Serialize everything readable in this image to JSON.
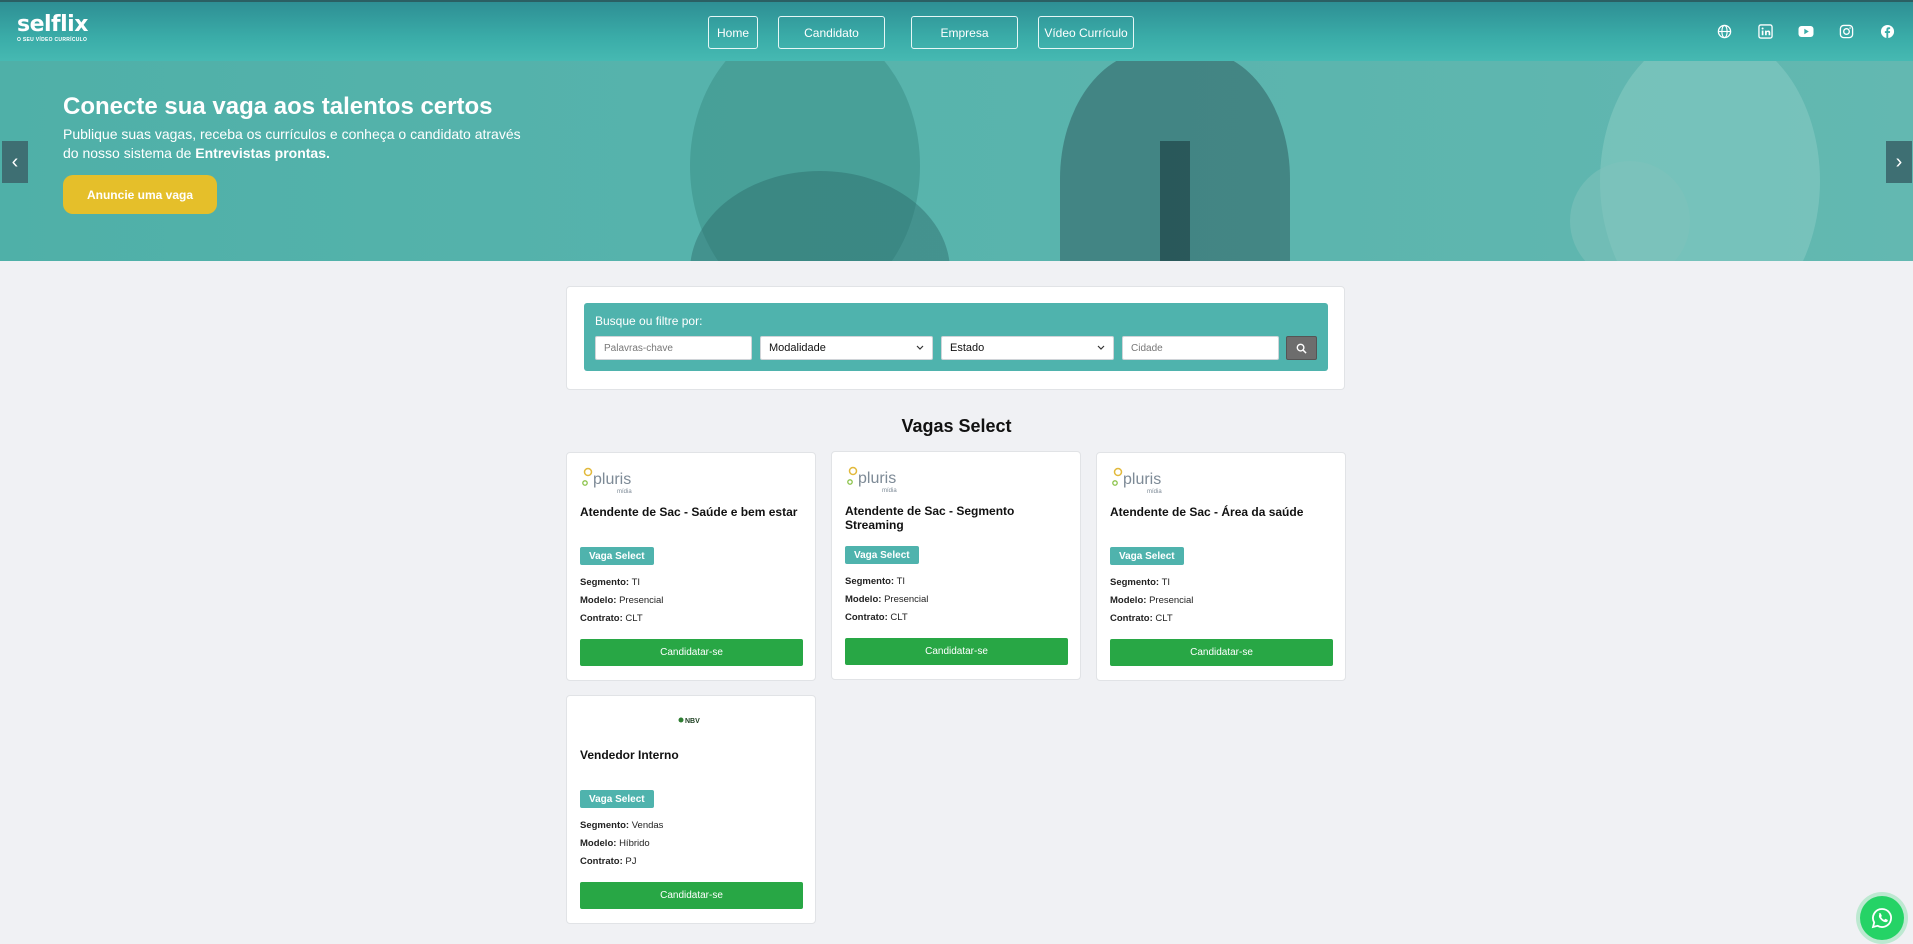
{
  "header": {
    "logo_text": "selflix",
    "logo_tagline": "O SEU VÍDEO CURRÍCULO",
    "nav": [
      {
        "label": "Home"
      },
      {
        "label": "Candidato"
      },
      {
        "label": "Empresa"
      },
      {
        "label": "Vídeo Currículo"
      }
    ],
    "social_icons": [
      "globe-icon",
      "linkedin-icon",
      "youtube-icon",
      "instagram-icon",
      "facebook-icon"
    ]
  },
  "hero": {
    "title": "Conecte sua vaga aos talentos certos",
    "subtitle_prefix": "Publique suas vagas, receba os currículos e conheça o candidato através do nosso sistema de ",
    "subtitle_bold": "Entrevistas prontas.",
    "cta_label": "Anuncie uma vaga",
    "prev_icon": "chevron-left-icon",
    "next_icon": "chevron-right-icon"
  },
  "search": {
    "label": "Busque ou filtre por:",
    "keywords_placeholder": "Palavras-chave",
    "modalidade_value": "Modalidade",
    "estado_value": "Estado",
    "cidade_placeholder": "Cidade",
    "button_icon": "search-icon"
  },
  "section_title": "Vagas Select",
  "jobs": [
    {
      "brand": "pluris",
      "brand_sub": "mídia",
      "title": "Atendente de Sac - Saúde e bem estar",
      "badge": "Vaga Select",
      "segmento_label": "Segmento:",
      "segmento": "TI",
      "modelo_label": "Modelo:",
      "modelo": "Presencial",
      "contrato_label": "Contrato:",
      "contrato": "CLT",
      "apply": "Candidatar-se"
    },
    {
      "brand": "pluris",
      "brand_sub": "mídia",
      "title": "Atendente de Sac - Segmento Streaming",
      "badge": "Vaga Select",
      "segmento_label": "Segmento:",
      "segmento": "TI",
      "modelo_label": "Modelo:",
      "modelo": "Presencial",
      "contrato_label": "Contrato:",
      "contrato": "CLT",
      "apply": "Candidatar-se"
    },
    {
      "brand": "pluris",
      "brand_sub": "mídia",
      "title": "Atendente de Sac - Área da saúde",
      "badge": "Vaga Select",
      "segmento_label": "Segmento:",
      "segmento": "TI",
      "modelo_label": "Modelo:",
      "modelo": "Presencial",
      "contrato_label": "Contrato:",
      "contrato": "CLT",
      "apply": "Candidatar-se"
    },
    {
      "brand": "NBV",
      "brand_sub": "",
      "title": "Vendedor Interno",
      "badge": "Vaga Select",
      "segmento_label": "Segmento:",
      "segmento": "Vendas",
      "modelo_label": "Modelo:",
      "modelo": "Híbrido",
      "contrato_label": "Contrato:",
      "contrato": "PJ",
      "apply": "Candidatar-se"
    }
  ],
  "colors": {
    "teal": "#4fb3ad",
    "green": "#28a745",
    "yellow": "#e5bf2a",
    "whatsapp": "#25d366"
  },
  "floating": {
    "icon": "whatsapp-icon"
  }
}
